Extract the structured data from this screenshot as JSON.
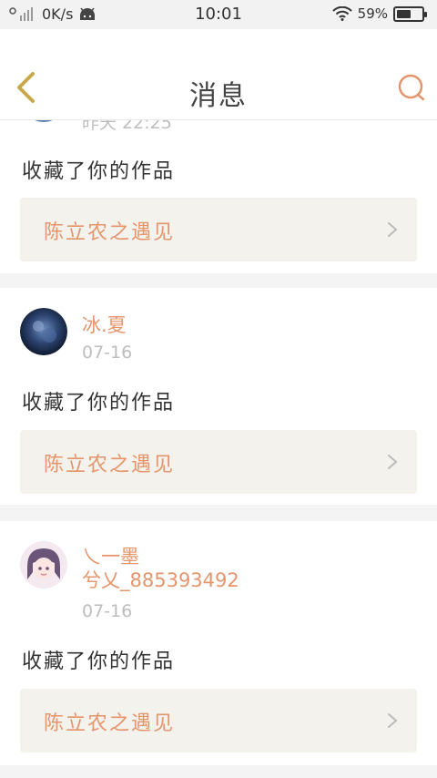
{
  "status_bar": {
    "net_speed": "0K/s",
    "time": "10:01",
    "battery_percent": "59%",
    "battery_level": 0.59
  },
  "header": {
    "title": "消息"
  },
  "colors": {
    "accent": "#e5956c",
    "muted": "#bdbdbd",
    "card_link_bg": "#f3f2ec"
  },
  "notifications": [
    {
      "timestamp": "昨天 22:25",
      "action": "收藏了你的作品",
      "work_title": "陈立农之遇见"
    },
    {
      "username": "冰.夏",
      "timestamp": "07-16",
      "action": "收藏了你的作品",
      "work_title": "陈立农之遇见"
    },
    {
      "username": "乀一墨",
      "username_line2": "兮乂_885393492",
      "timestamp": "07-16",
      "action": "收藏了你的作品",
      "work_title": "陈立农之遇见"
    }
  ]
}
